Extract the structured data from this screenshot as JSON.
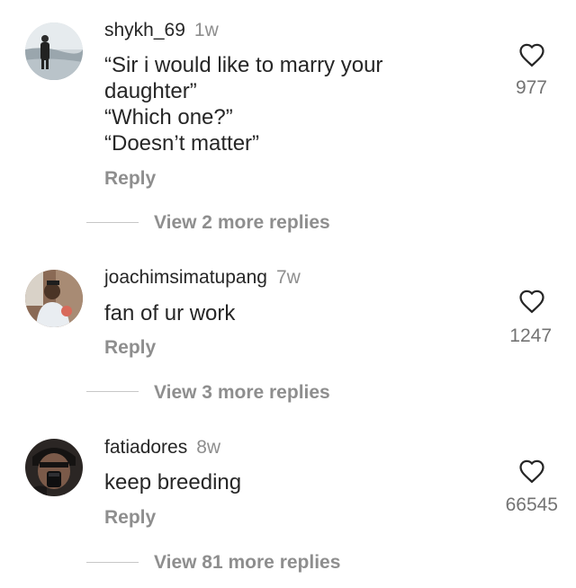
{
  "comments": [
    {
      "username": "shykh_69",
      "time": "1w",
      "text": "“Sir i would like to marry your\ndaughter”\n“Which one?”\n“Doesn’t matter”",
      "reply_label": "Reply",
      "view_replies": "View 2 more replies",
      "likes": "977",
      "avatar_icon": "avatar-icon"
    },
    {
      "username": "joachimsimatupang",
      "time": "7w",
      "text": "fan of ur work",
      "reply_label": "Reply",
      "view_replies": "View 3 more replies",
      "likes": "1247",
      "avatar_icon": "avatar-icon"
    },
    {
      "username": "fatiadores",
      "time": "8w",
      "text": "keep breeding",
      "reply_label": "Reply",
      "view_replies": "View 81 more replies",
      "likes": "66545",
      "avatar_icon": "avatar-icon"
    }
  ],
  "colors": {
    "text": "#262626",
    "muted": "#8e8e8e",
    "heart": "#262626"
  },
  "icons": {
    "like": "heart-outline-icon"
  }
}
